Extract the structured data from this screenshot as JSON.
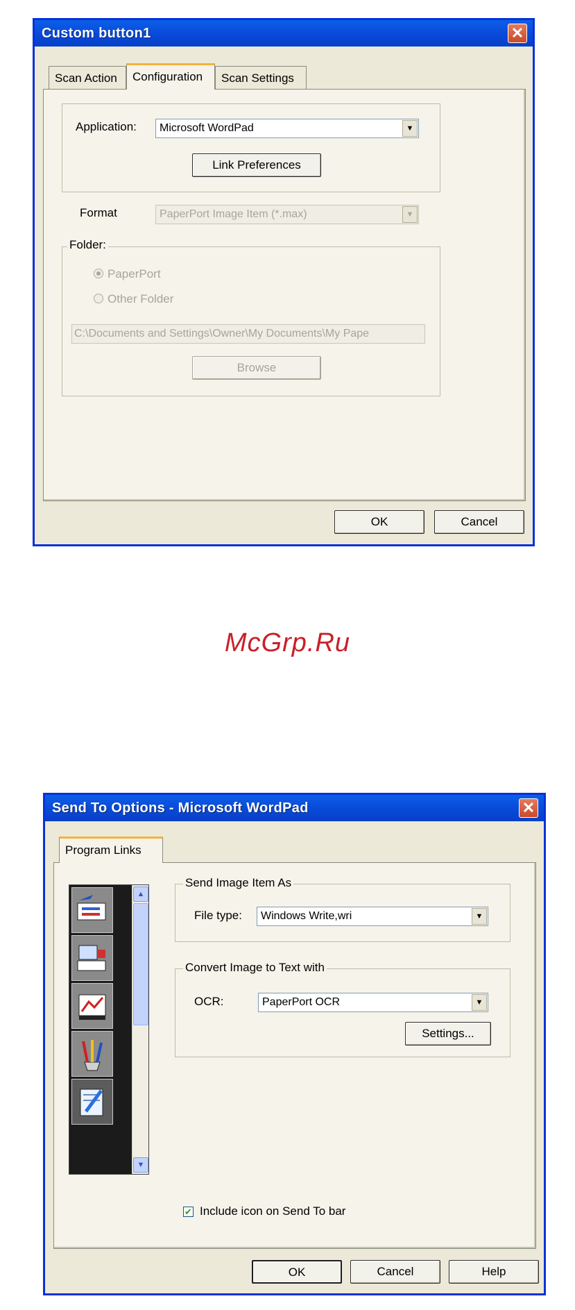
{
  "dialog1": {
    "title": "Custom button1",
    "close_glyph": "✕",
    "tabs": [
      {
        "label": "Scan Action"
      },
      {
        "label": "Configuration"
      },
      {
        "label": "Scan Settings"
      }
    ],
    "application_label": "Application:",
    "application_value": "Microsoft WordPad",
    "link_preferences_label": "Link Preferences",
    "format_label": "Format",
    "format_value": "PaperPort Image Item (*.max)",
    "folder_legend": "Folder:",
    "radio_paperport": "PaperPort",
    "radio_other_folder": "Other Folder",
    "folder_path": "C:\\Documents and Settings\\Owner\\My Documents\\My Pape",
    "browse_label": "Browse",
    "ok_label": "OK",
    "cancel_label": "Cancel"
  },
  "watermark": "McGrp.Ru",
  "dialog2": {
    "title": "Send To Options - Microsoft WordPad",
    "close_glyph": "✕",
    "tab_label": "Program Links",
    "send_image_legend": "Send Image Item As",
    "file_type_label": "File type:",
    "file_type_value": "Windows Write,wri",
    "convert_legend": "Convert Image to Text with",
    "ocr_label": "OCR:",
    "ocr_value": "PaperPort OCR",
    "settings_label": "Settings...",
    "include_icon_label": "Include icon on Send To bar",
    "include_icon_checked": true,
    "check_glyph": "✔",
    "ok_label": "OK",
    "cancel_label": "Cancel",
    "help_label": "Help"
  }
}
